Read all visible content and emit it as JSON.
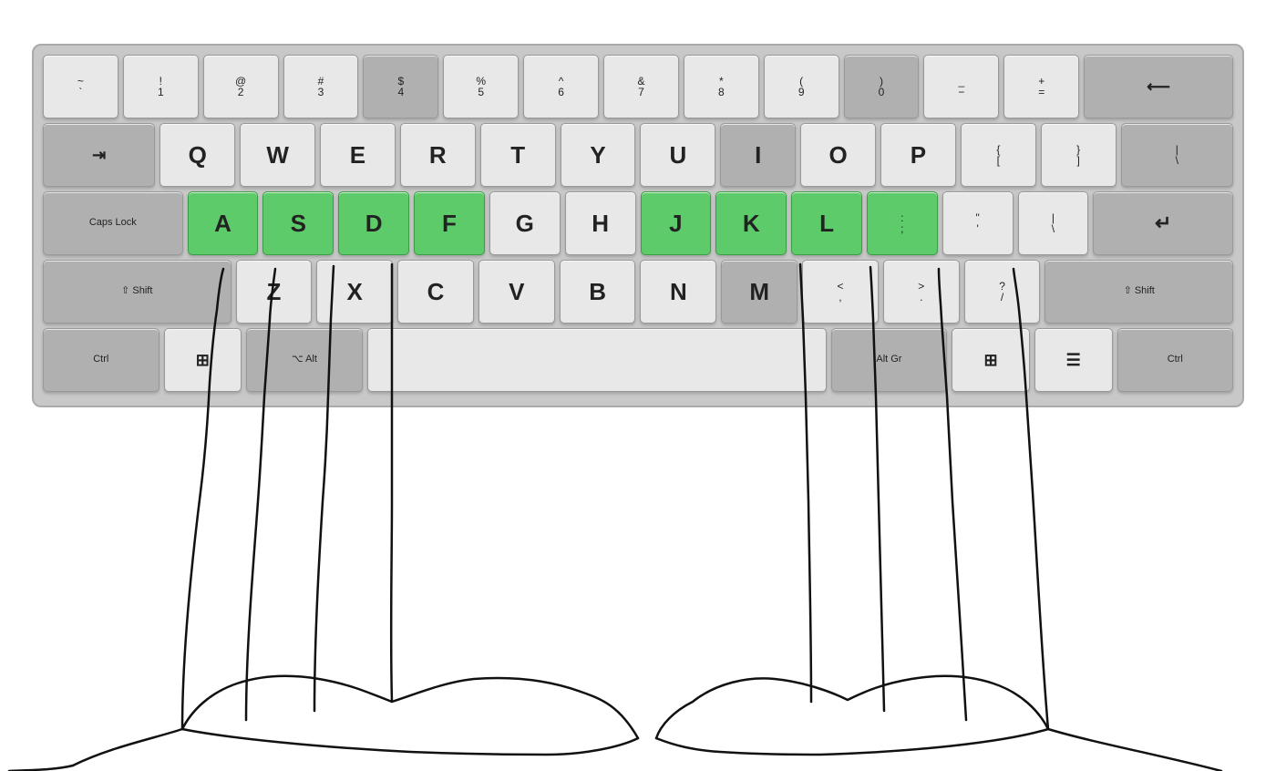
{
  "keyboard": {
    "rows": [
      {
        "keys": [
          {
            "label_top": "~",
            "label_bot": "`",
            "type": "normal",
            "width": "normal"
          },
          {
            "label_top": "!",
            "label_bot": "1",
            "type": "normal"
          },
          {
            "label_top": "@",
            "label_bot": "2",
            "type": "normal"
          },
          {
            "label_top": "#",
            "label_bot": "3",
            "type": "normal"
          },
          {
            "label_top": "$",
            "label_bot": "4",
            "type": "dark"
          },
          {
            "label_top": "%",
            "label_bot": "5",
            "type": "normal"
          },
          {
            "label_top": "^",
            "label_bot": "6",
            "type": "normal"
          },
          {
            "label_top": "&",
            "label_bot": "7",
            "type": "normal"
          },
          {
            "label_top": "*",
            "label_bot": "8",
            "type": "normal"
          },
          {
            "label_top": "(",
            "label_bot": "9",
            "type": "normal"
          },
          {
            "label_top": ")",
            "label_bot": "0",
            "type": "dark"
          },
          {
            "label_top": "_",
            "label_bot": "-",
            "type": "normal"
          },
          {
            "label_top": "+",
            "label_bot": "=",
            "type": "normal"
          },
          {
            "label_top": "⟵",
            "label_bot": "",
            "type": "dark",
            "width": "wide-2"
          }
        ]
      },
      {
        "keys": [
          {
            "label_main": "⇥",
            "label_sub": "",
            "type": "dark",
            "width": "wide-1-5"
          },
          {
            "label_main": "Q",
            "type": "normal"
          },
          {
            "label_main": "W",
            "type": "normal"
          },
          {
            "label_main": "E",
            "type": "normal"
          },
          {
            "label_main": "R",
            "type": "normal"
          },
          {
            "label_main": "T",
            "type": "normal"
          },
          {
            "label_main": "Y",
            "type": "normal"
          },
          {
            "label_main": "U",
            "type": "normal"
          },
          {
            "label_main": "I",
            "type": "dark"
          },
          {
            "label_main": "O",
            "type": "normal"
          },
          {
            "label_main": "P",
            "type": "normal"
          },
          {
            "label_top": "{",
            "label_bot": "[",
            "type": "normal"
          },
          {
            "label_top": "}",
            "label_bot": "]",
            "type": "normal"
          },
          {
            "label_top": "|",
            "label_bot": "\\",
            "type": "normal",
            "width": "wide-1-5"
          }
        ]
      },
      {
        "keys": [
          {
            "label_main": "Caps Lock",
            "type": "dark",
            "width": "wide-2"
          },
          {
            "label_main": "A",
            "type": "green"
          },
          {
            "label_main": "S",
            "type": "green"
          },
          {
            "label_main": "D",
            "type": "green"
          },
          {
            "label_main": "F",
            "type": "green"
          },
          {
            "label_main": "G",
            "type": "normal"
          },
          {
            "label_main": "H",
            "type": "normal"
          },
          {
            "label_main": "J",
            "type": "green"
          },
          {
            "label_main": "K",
            "type": "green"
          },
          {
            "label_main": "L",
            "type": "green"
          },
          {
            "label_top": ":",
            "label_bot": ";",
            "type": "green"
          },
          {
            "label_top": "\"",
            "label_bot": "'",
            "type": "normal"
          },
          {
            "label_top": "|",
            "label_bot": "\\",
            "type": "normal"
          },
          {
            "label_main": "↵",
            "type": "dark",
            "width": "wide-2"
          }
        ]
      },
      {
        "keys": [
          {
            "label_main": "⇧ Shift",
            "type": "dark",
            "width": "wide-2-5"
          },
          {
            "label_main": "Z",
            "type": "normal"
          },
          {
            "label_main": "X",
            "type": "normal"
          },
          {
            "label_main": "C",
            "type": "normal"
          },
          {
            "label_main": "V",
            "type": "normal"
          },
          {
            "label_main": "B",
            "type": "normal"
          },
          {
            "label_main": "N",
            "type": "normal"
          },
          {
            "label_main": "M",
            "type": "dark"
          },
          {
            "label_top": "<",
            "label_bot": ",",
            "type": "normal"
          },
          {
            "label_top": ">",
            "label_bot": ".",
            "type": "normal"
          },
          {
            "label_top": "?",
            "label_bot": "/",
            "type": "normal"
          },
          {
            "label_main": "⇧ Shift",
            "type": "dark",
            "width": "wide-2-5"
          }
        ]
      },
      {
        "keys": [
          {
            "label_main": "Ctrl",
            "type": "dark",
            "width": "wide-1-5"
          },
          {
            "label_main": "⊞",
            "type": "normal"
          },
          {
            "label_main": "⌥ Alt",
            "type": "dark",
            "width": "wide-1-5"
          },
          {
            "label_main": "",
            "type": "normal",
            "width": "wide-6"
          },
          {
            "label_main": "Alt Gr",
            "type": "dark",
            "width": "wide-1-5"
          },
          {
            "label_main": "⊞",
            "type": "normal"
          },
          {
            "label_main": "☰",
            "type": "normal"
          },
          {
            "label_main": "Ctrl",
            "type": "dark",
            "width": "wide-1-5"
          }
        ]
      }
    ]
  }
}
